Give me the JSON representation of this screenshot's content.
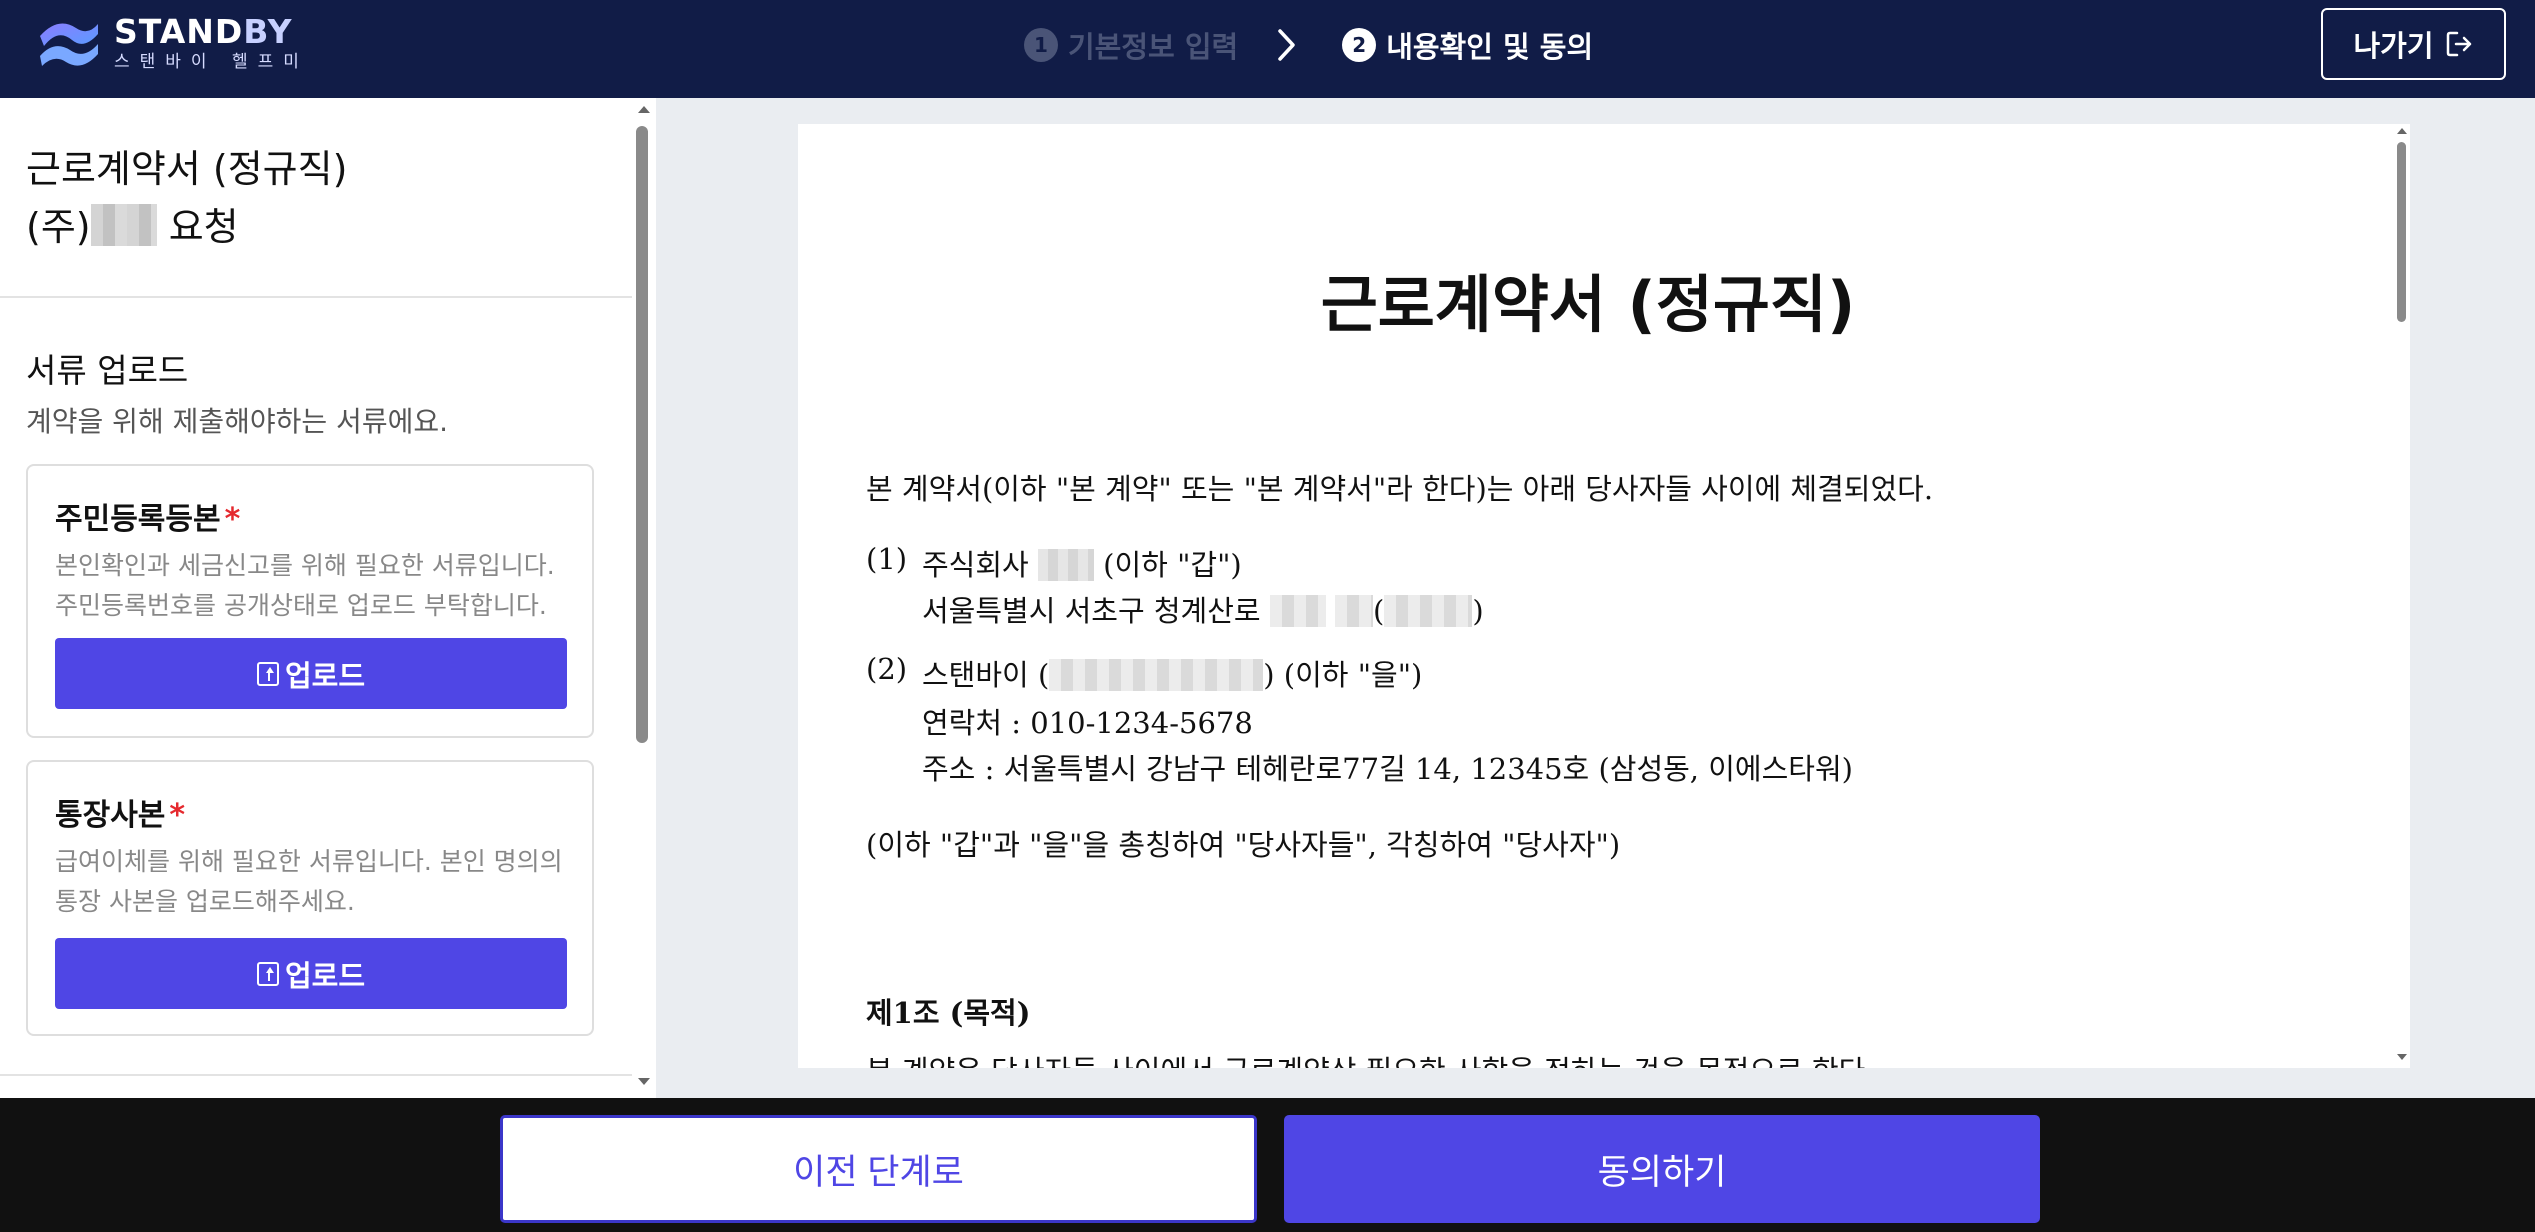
{
  "header": {
    "logo": {
      "name_main": "STAND",
      "name_accent": "BY",
      "subtitle": "스탠바이 헬프미",
      "icon": "standby-logo-icon"
    },
    "steps": [
      {
        "number": "1",
        "label": "기본정보 입력",
        "state": "inactive"
      },
      {
        "number": "2",
        "label": "내용확인 및 동의",
        "state": "active"
      }
    ],
    "exit_label": "나가기",
    "exit_icon": "logout-icon"
  },
  "sidebar": {
    "title_line1": "근로계약서 (정규직)",
    "title_line2_prefix": "(주)",
    "title_line2_suffix": " 요청",
    "section_title": "서류 업로드",
    "section_desc": "계약을 위해 제출해야하는 서류에요.",
    "documents": [
      {
        "title": "주민등록등본",
        "required_mark": "*",
        "desc": "본인확인과 세금신고를 위해 필요한 서류입니다. 주민등록번호를 공개상태로 업로드 부탁합니다.",
        "button": "업로드"
      },
      {
        "title": "통장사본",
        "required_mark": "*",
        "desc": "급여이체를 위해 필요한 서류입니다. 본인 명의의 통장 사본을 업로드해주세요.",
        "button": "업로드"
      }
    ]
  },
  "document": {
    "title": "근로계약서 (정규직)",
    "intro": "본 계약서(이하 \"본 계약\" 또는 \"본 계약서\"라 한다)는 아래 당사자들 사이에 체결되었다.",
    "party1": {
      "num": "(1)",
      "line1_prefix": "주식회사",
      "line1_suffix": "(이하 \"갑\")",
      "line2_prefix": "서울특별시 서초구 청계산로",
      "line2_open": "(",
      "line2_close": ")"
    },
    "party2": {
      "num": "(2)",
      "line1_prefix": "스탠바이 (",
      "line1_suffix": ") (이하 \"을\")",
      "contact": "연락처 : 010-1234-5678",
      "address": "주소 : 서울특별시 강남구 테헤란로77길 14, 12345호 (삼성동, 이에스타워)"
    },
    "collective": "(이하 \"갑\"과 \"을\"을 총칭하여 \"당사자들\", 각칭하여 \"당사자\")",
    "article1_title": "제1조 (목적)",
    "article1_text": "본 계약은 당사자들 사이에서 근로계약상 필요한 사항을 정하는 것을 목적으로 한다."
  },
  "footer": {
    "prev_label": "이전 단계로",
    "agree_label": "동의하기"
  },
  "colors": {
    "header_bg": "#111c47",
    "primary": "#4f46e5",
    "required": "#e5292e",
    "footer_bg": "#111111"
  }
}
